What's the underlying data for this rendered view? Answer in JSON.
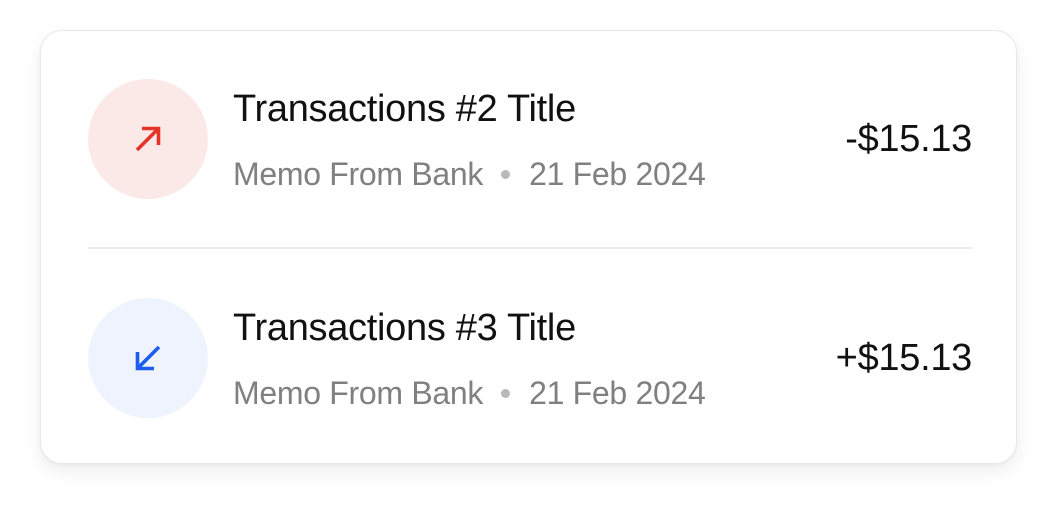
{
  "transactions": [
    {
      "direction": "outgoing",
      "icon": "arrow-up-right-icon",
      "icon_color": "#e5332a",
      "icon_bg": "#fbe9e8",
      "title": "Transactions #2 Title",
      "memo": "Memo From Bank",
      "date": "21 Feb 2024",
      "amount": "-$15.13"
    },
    {
      "direction": "incoming",
      "icon": "arrow-down-left-icon",
      "icon_color": "#1d5cf0",
      "icon_bg": "#eef3fd",
      "title": "Transactions #3 Title",
      "memo": "Memo From Bank",
      "date": "21 Feb 2024",
      "amount": "+$15.13"
    }
  ]
}
